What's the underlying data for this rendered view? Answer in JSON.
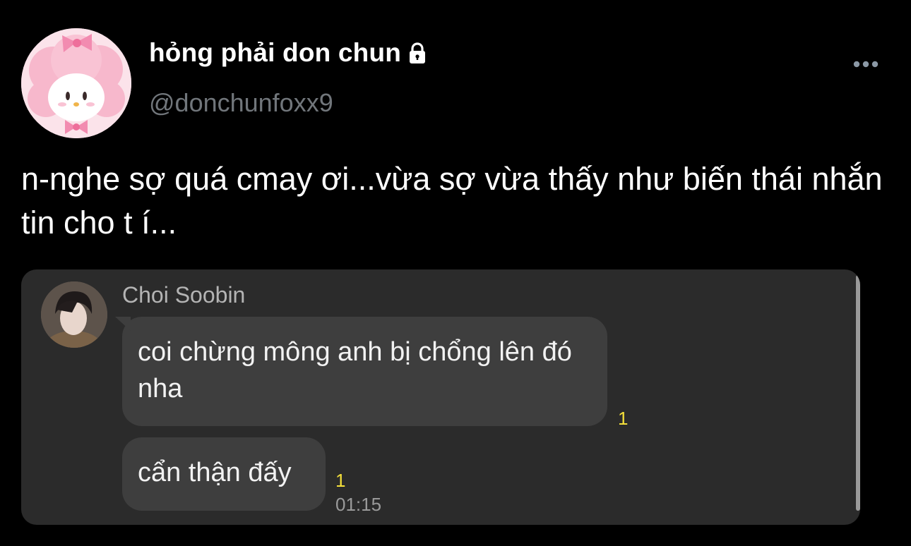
{
  "tweet": {
    "author": {
      "display_name": "hỏng phải don chun",
      "handle": "@donchunfoxx9",
      "protected_icon": "lock-icon",
      "avatar": "pink-sheep-character-avatar"
    },
    "more_icon": "more-horizontal-icon",
    "text": "n-nghe sợ quá cmay ơi...vừa sợ vừa thấy như biến thái nhắn tin cho t í..."
  },
  "attached_image": {
    "chat": {
      "sender_name": "Choi Soobin",
      "messages": [
        {
          "text": "coi chừng mông anh bị chổng lên đó nha",
          "unread_count": "1"
        },
        {
          "text": "cẩn thận đấy",
          "unread_count": "1",
          "time": "01:15"
        }
      ]
    }
  },
  "colors": {
    "background": "#000000",
    "handle": "#71767b",
    "chat_background": "#2b2b2b",
    "bubble": "#3e3e3e",
    "unread": "#f4df3a"
  }
}
